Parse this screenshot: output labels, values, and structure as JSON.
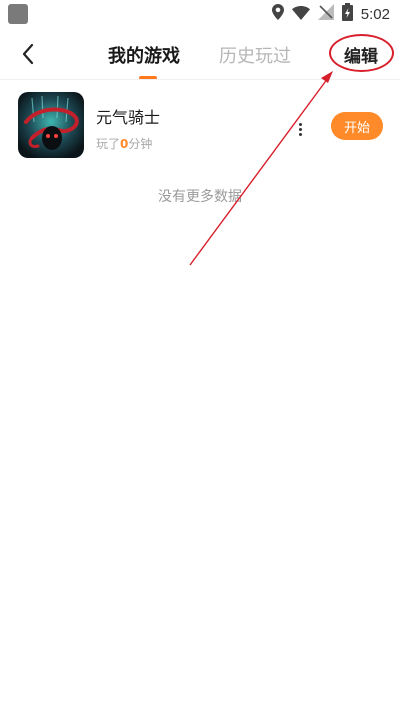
{
  "status_bar": {
    "time": "5:02",
    "icons": [
      "location-icon",
      "wifi-icon",
      "no-signal-icon",
      "battery-charging-icon"
    ]
  },
  "header": {
    "back_icon": "chevron-left-icon",
    "tabs": [
      {
        "label": "我的游戏",
        "active": true
      },
      {
        "label": "历史玩过",
        "active": false
      }
    ],
    "edit_label": "编辑",
    "accent_color": "#ff7a1f",
    "annotation_color": "#d8202c"
  },
  "games": [
    {
      "title": "元气骑士",
      "played_prefix": "玩了",
      "played_value": "0",
      "played_unit": "分钟",
      "start_label": "开始"
    }
  ],
  "list_footer": "没有更多数据"
}
